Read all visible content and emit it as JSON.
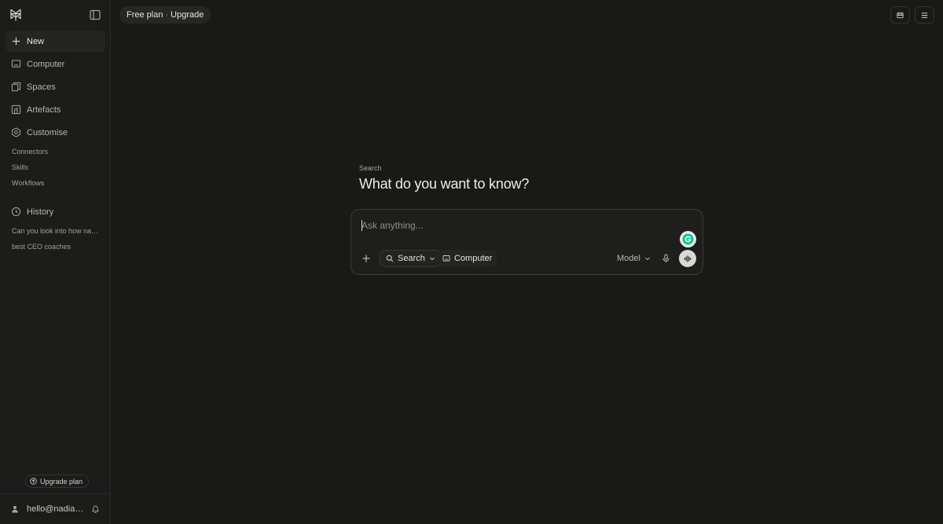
{
  "sidebar": {
    "nav": [
      {
        "label": "New",
        "icon": "plus-icon"
      },
      {
        "label": "Computer",
        "icon": "computer-icon"
      },
      {
        "label": "Spaces",
        "icon": "spaces-icon"
      },
      {
        "label": "Artefacts",
        "icon": "artefacts-icon"
      },
      {
        "label": "Customise",
        "icon": "customise-icon"
      }
    ],
    "sub_items": [
      "Connectors",
      "Skills",
      "Workflows"
    ],
    "history": {
      "label": "History",
      "items": [
        "Can you look into how nadia...",
        "best CEO coaches"
      ]
    },
    "upgrade_label": "Upgrade plan",
    "user_email": "hello@nadiamakarevich.com"
  },
  "topbar": {
    "plan": "Free plan",
    "separator": "·",
    "upgrade": "Upgrade"
  },
  "main": {
    "section_label": "Search",
    "headline": "What do you want to know?"
  },
  "composer": {
    "placeholder": "Ask anything...",
    "value": "",
    "mode_search": "Search",
    "mode_computer": "Computer",
    "model_label": "Model"
  },
  "theme": {
    "background": "#191918",
    "sidebar": "#1c1c1b",
    "text": "#e8e8e6"
  }
}
